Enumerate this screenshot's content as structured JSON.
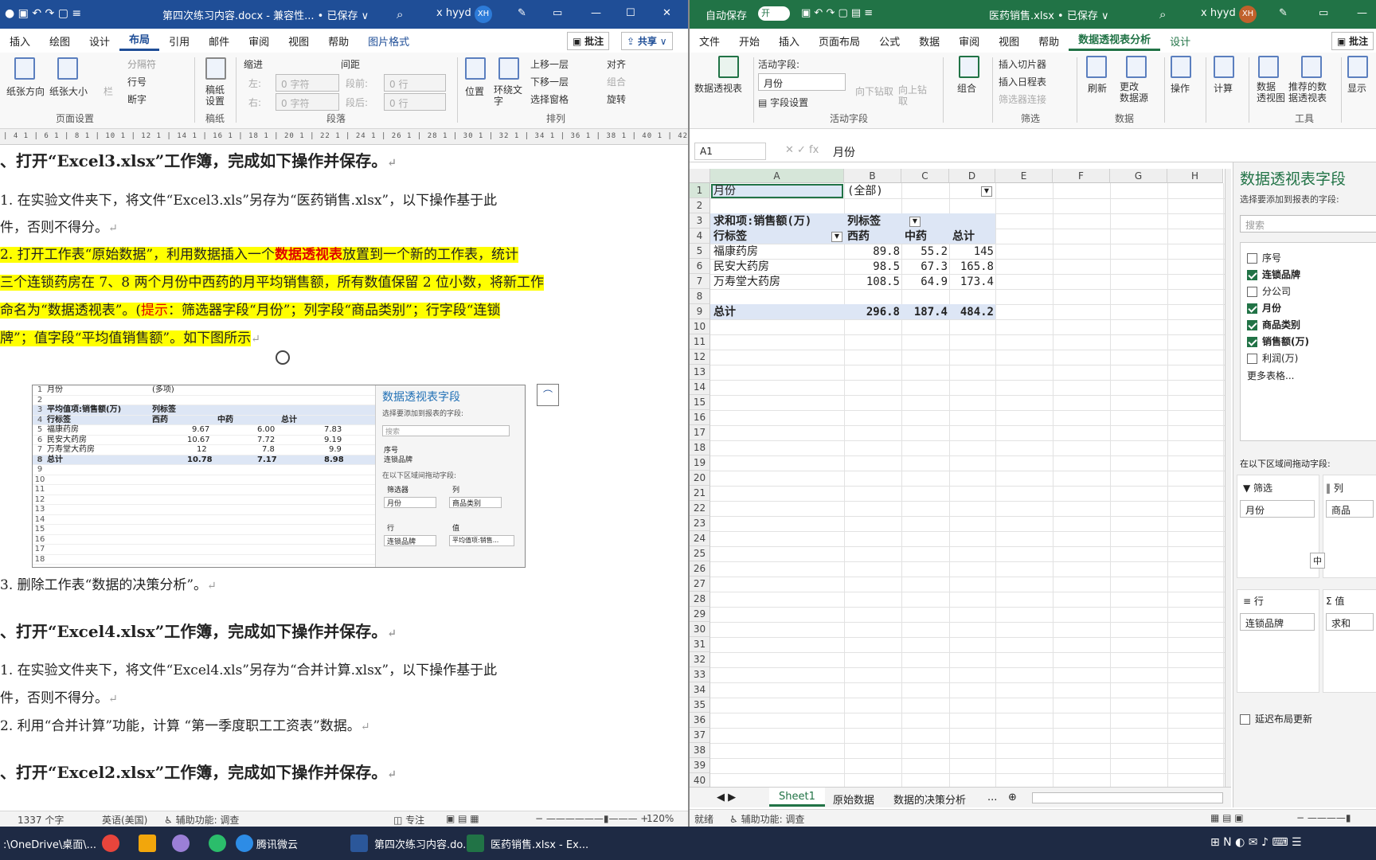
{
  "word": {
    "title": "第四次练习内容.docx  -  兼容性...  •  已保存 ∨",
    "user": "x hyyd",
    "avatar": "XH",
    "tabs": [
      "插入",
      "绘图",
      "设计",
      "布局",
      "引用",
      "邮件",
      "审阅",
      "视图",
      "帮助",
      "图片格式"
    ],
    "active_tab": "布局",
    "comment_btn": "批注",
    "share_btn": "共享",
    "ribbon": {
      "paper_dir": "纸张方向",
      "paper_size": "纸张大小",
      "columns": "栏",
      "separator": "分隔符",
      "line_no": "行号",
      "hyphen": "断字",
      "page_setup": "页面设置",
      "draft": "稿纸\n设置",
      "draft_grp": "稿纸",
      "indent": "缩进",
      "spacing": "间距",
      "left": "左:",
      "right": "右:",
      "before": "段前:",
      "after": "段后:",
      "zero_char": "0 字符",
      "zero_row": "0 行",
      "paragraph": "段落",
      "position": "位置",
      "wrap": "环绕文\n字",
      "bring_fwd": "上移一层",
      "send_back": "下移一层",
      "select_pane": "选择窗格",
      "align": "对齐",
      "group": "组合",
      "rotate": "旋转",
      "arrange": "排列"
    },
    "ruler": "| 4 1  | 6 1  | 8 1  | 10 1 | 12 1 | 14 1 | 16 1 | 18 1 | 20 1 | 22 1 | 24 1 | 26 1 | 28 1 | 30 1 | 32 1 | 34 1 | 36 1 | 38 1 | 40 1 | 42 1 | 44 1 | 46 1 | 48 1 | 50 1",
    "doc": {
      "h3": "、打开“Excel3.xlsx”工作簿，完成如下操作并保存。",
      "p1a": " 1. 在实验文件夹下，将文件“Excel3.xls”另存为“医药销售.xlsx”，以下操作基于此",
      "p1b": "件，否则不得分。",
      "p2a_1": " 2. 打开工作表“原始数据”，利用数据插入一个",
      "p2a_2": "数据透视表",
      "p2a_3": "放置到一个新的工作表，统计",
      "p2b": "三个连锁药房在 7、8 两个月份中西药的月平均销售额，所有数值保留 2 位小数，将新工作",
      "p2c_1": "命名为“数据透视表”。(",
      "p2c_2": "提示",
      "p2c_3": "：筛选器字段“月份”；列字段“商品类别”；行字段“连锁",
      "p2d": "牌”；值字段“平均值销售额”。如下图所示",
      "p3": " 3. 删除工作表“数据的决策分析”。",
      "h4": "、打开“Excel4.xlsx”工作簿，完成如下操作并保存。",
      "p4a": " 1. 在实验文件夹下，将文件“Excel4.xls”另存为“合并计算.xlsx”，以下操作基于此",
      "p4b": "件，否则不得分。",
      "p5": " 2. 利用“合并计算”功能，计算 “第一季度职工工资表”数据。",
      "h2": "、打开“Excel2.xlsx”工作簿，完成如下操作并保存。",
      "para_mark": "↵"
    },
    "embedded": {
      "r1": [
        "月份",
        "(多项)"
      ],
      "r3": [
        "平均值项:销售额(万)",
        "列标签"
      ],
      "r4": [
        "行标签",
        "西药",
        "中药",
        "总计"
      ],
      "rows": [
        [
          "福康药房",
          "9.67",
          "6.00",
          "7.83"
        ],
        [
          "民安大药房",
          "10.67",
          "7.72",
          "9.19"
        ],
        [
          "万寿堂大药房",
          "12",
          "7.8",
          "9.9"
        ],
        [
          "总计",
          "10.78",
          "7.17",
          "8.98"
        ]
      ],
      "pane_title": "数据透视表字段",
      "pane_sub": "选择要添加到报表的字段:",
      "search": "搜索",
      "f1": "序号",
      "f2": "连锁品牌",
      "drag": "在以下区域间拖动字段:",
      "filter": "筛选器",
      "col": "列",
      "row": "行",
      "val": "值",
      "filter_v": "月份",
      "col_v": "商品类别",
      "row_v": "连锁品牌",
      "val_v": "平均值项:销售..."
    },
    "status": {
      "words": "1337 个字",
      "lang": "英语(美国)",
      "access": "辅助功能: 调查",
      "focus": "专注",
      "zoom": "120%"
    }
  },
  "excel": {
    "autosave": "自动保存",
    "on": "开",
    "title": "医药销售.xlsx  •  已保存 ∨",
    "user": "x hyyd",
    "avatar": "XH",
    "tabs": [
      "文件",
      "开始",
      "插入",
      "页面布局",
      "公式",
      "数据",
      "审阅",
      "视图",
      "帮助",
      "数据透视表分析",
      "设计"
    ],
    "active_tab": "数据透视表分析",
    "comment_btn": "批注",
    "ribbon": {
      "pivot": "数据透视表",
      "active_field": "活动字段:",
      "field_value": "月份",
      "field_settings": "字段设置",
      "drill_down": "向下钻取",
      "drill_up": "向上钻\n取",
      "active_grp": "活动字段",
      "group": "组合",
      "ins_slicer": "插入切片器",
      "ins_timeline": "插入日程表",
      "filter_conn": "筛选器连接",
      "filter_grp": "筛选",
      "refresh": "刷新",
      "change_src": "更改\n数据源",
      "data_grp": "数据",
      "action": "操作",
      "calc": "计算",
      "pivot_chart": "数据\n透视图",
      "recommend": "推荐的数\n据透视表",
      "tools_grp": "工具",
      "show": "显示"
    },
    "namebox": "A1",
    "formula": "月份",
    "cols": [
      "A",
      "B",
      "C",
      "D",
      "E",
      "F",
      "G",
      "H"
    ],
    "cells": {
      "r1a": "月份",
      "r1b": "(全部)",
      "r3a": "求和项:销售额(万)",
      "r3b": "列标签",
      "r4a": "行标签",
      "r4b": "西药",
      "r4c": "中药",
      "r4d": "总计",
      "rows": [
        [
          "福康药房",
          "89.8",
          "55.2",
          "145"
        ],
        [
          "民安大药房",
          "98.5",
          "67.3",
          "165.8"
        ],
        [
          "万寿堂大药房",
          "108.5",
          "64.9",
          "173.4"
        ],
        [
          "总计",
          "296.8",
          "187.4",
          "484.2"
        ]
      ]
    },
    "sheets": [
      "Sheet1",
      "原始数据",
      "数据的决策分析",
      "..."
    ],
    "active_sheet": "Sheet1",
    "status": {
      "ready": "就绪",
      "access": "辅助功能: 调查"
    },
    "pane": {
      "title": "数据透视表字段",
      "sub": "选择要添加到报表的字段:",
      "search": "搜索",
      "fields": [
        {
          "name": "序号",
          "checked": false
        },
        {
          "name": "连锁品牌",
          "checked": true
        },
        {
          "name": "分公司",
          "checked": false
        },
        {
          "name": "月份",
          "checked": true
        },
        {
          "name": "商品类别",
          "checked": true
        },
        {
          "name": "销售额(万)",
          "checked": true
        },
        {
          "name": "利润(万)",
          "checked": false
        }
      ],
      "more": "更多表格...",
      "drag": "在以下区域间拖动字段:",
      "filter": "筛选",
      "col": "列",
      "row": "行",
      "val": "值",
      "filter_v": "月份",
      "col_v": "商品",
      "row_v": "连锁品牌",
      "val_v": "求和",
      "ime": "中",
      "defer": "延迟布局更新"
    }
  },
  "taskbar": {
    "path": ":\\OneDrive\\桌面\\...",
    "tencent": "腾讯微云",
    "word_task": "第四次练习内容.do...",
    "excel_task": "医药销售.xlsx - Ex..."
  }
}
